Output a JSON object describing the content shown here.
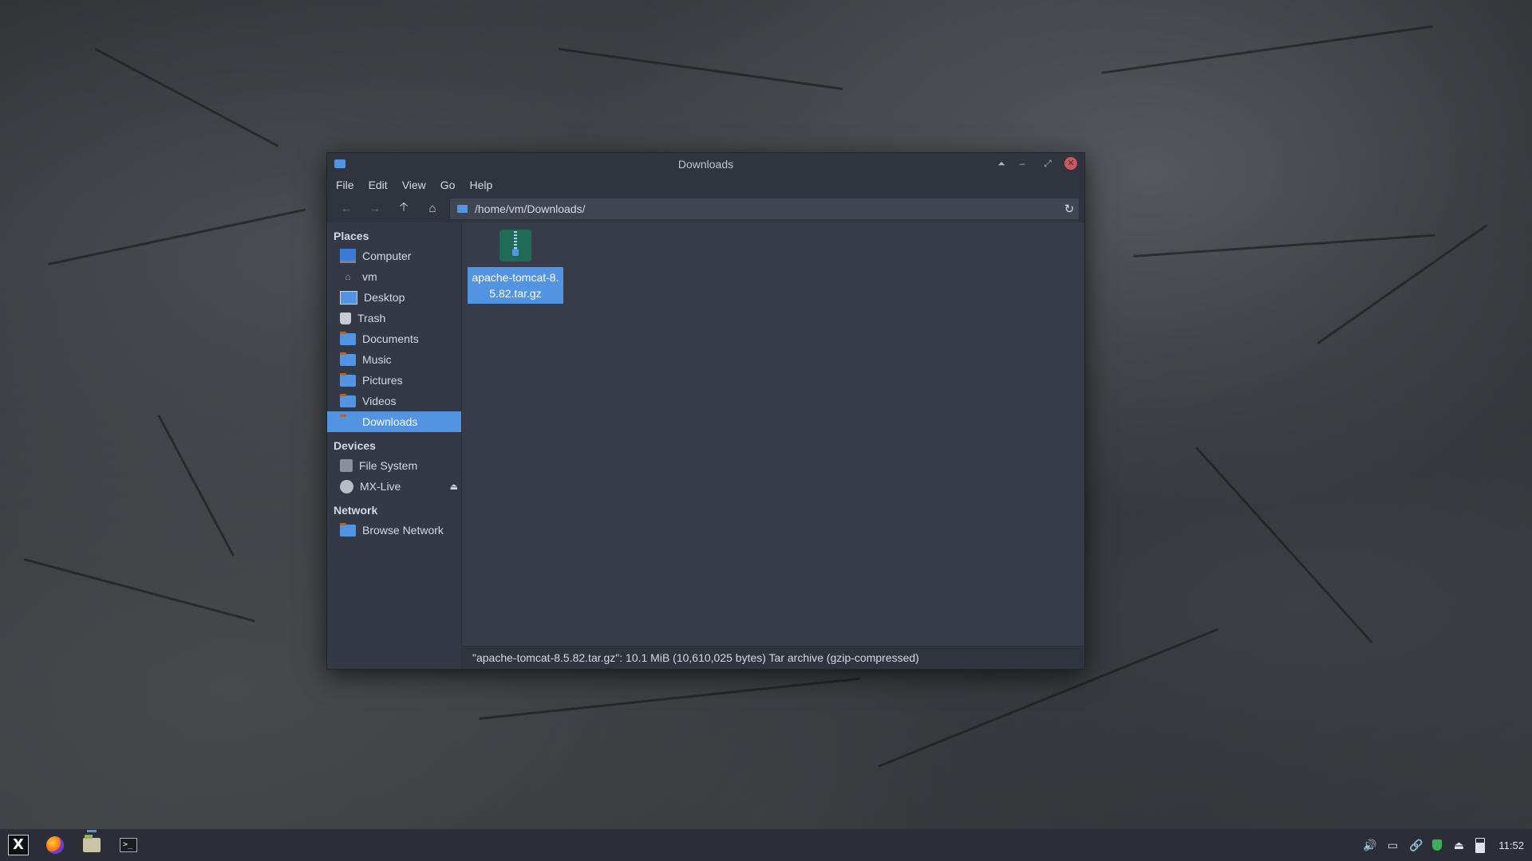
{
  "window": {
    "title": "Downloads",
    "buttons": {
      "up": "⏶",
      "minimize": "–",
      "maximize": "⤢",
      "close": "✕"
    }
  },
  "menu": [
    "File",
    "Edit",
    "View",
    "Go",
    "Help"
  ],
  "toolbar": {
    "back_icon": "←",
    "forward_icon": "→",
    "up_icon": "🡡",
    "home_icon": "⌂",
    "path": "/home/vm/Downloads/",
    "reload_icon": "↻"
  },
  "sidebar": {
    "places_title": "Places",
    "places": [
      {
        "label": "Computer",
        "icon": "computer-icon"
      },
      {
        "label": "vm",
        "icon": "home-icon"
      },
      {
        "label": "Desktop",
        "icon": "desktop-icon"
      },
      {
        "label": "Trash",
        "icon": "trash-icon"
      },
      {
        "label": "Documents",
        "icon": "folder-icon"
      },
      {
        "label": "Music",
        "icon": "folder-icon"
      },
      {
        "label": "Pictures",
        "icon": "folder-icon"
      },
      {
        "label": "Videos",
        "icon": "folder-icon"
      },
      {
        "label": "Downloads",
        "icon": "folder-icon",
        "active": true
      }
    ],
    "devices_title": "Devices",
    "devices": [
      {
        "label": "File System",
        "icon": "drive-icon"
      },
      {
        "label": "MX-Live",
        "icon": "disc-icon",
        "eject": "⏏"
      }
    ],
    "network_title": "Network",
    "network": [
      {
        "label": "Browse Network",
        "icon": "folder-icon"
      }
    ]
  },
  "files": [
    {
      "name": "apache-tomcat-8.5.82.tar.gz",
      "icon": "archive-icon",
      "selected": true
    }
  ],
  "statusbar": "\"apache-tomcat-8.5.82.tar.gz\": 10.1 MiB (10,610,025 bytes) Tar archive (gzip-compressed)",
  "taskbar": {
    "launchers": [
      "mx-menu-icon",
      "firefox-icon",
      "file-manager-icon",
      "terminal-icon"
    ],
    "terminal_glyph": ">_",
    "mx_glyph": "X",
    "tray": {
      "volume": "🔊",
      "screen": "▭",
      "link": "🔗",
      "eject": "⏏"
    },
    "clock": "11:52"
  },
  "colors": {
    "accent": "#5294e2",
    "window_bg": "#2f343f",
    "sidebar_bg": "#353945",
    "main_bg": "#383c4a"
  }
}
